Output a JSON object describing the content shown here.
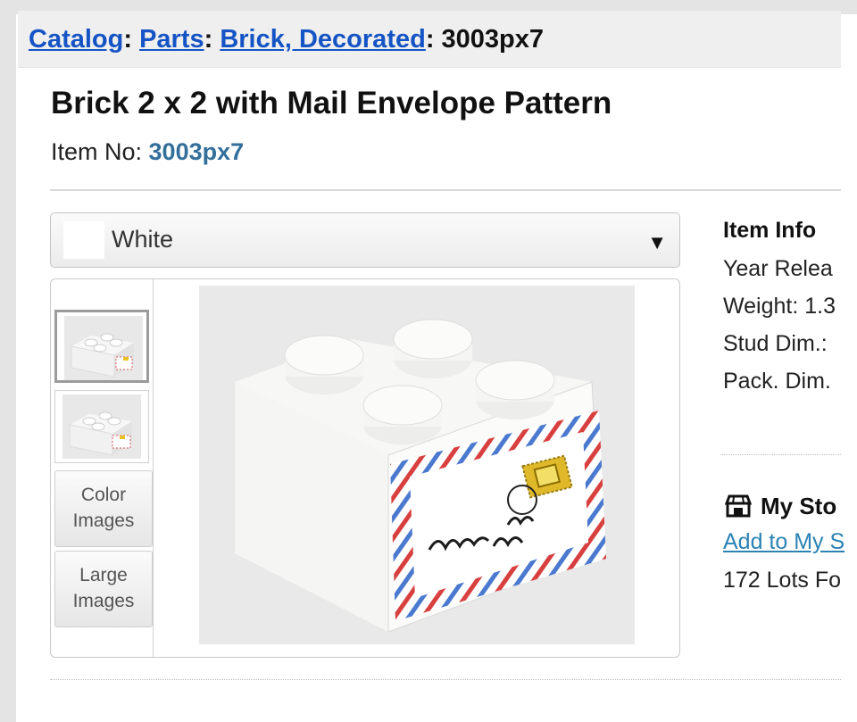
{
  "breadcrumb": {
    "items": [
      "Catalog",
      "Parts",
      "Brick, Decorated"
    ],
    "current": "3003px7"
  },
  "item": {
    "title": "Brick 2 x 2 with Mail Envelope Pattern",
    "item_no_label": "Item No: ",
    "item_no": "3003px7"
  },
  "color_select": {
    "selected": "White",
    "swatch_color": "#ffffff"
  },
  "gallery": {
    "color_images_label_1": "Color",
    "color_images_label_2": "Images",
    "large_images_label_1": "Large",
    "large_images_label_2": "Images"
  },
  "item_info": {
    "heading": "Item Info",
    "rows": [
      "Year Relea",
      "Weight: 1.3",
      "Stud Dim.:",
      "Pack. Dim."
    ]
  },
  "my_store": {
    "heading": "My Sto",
    "link": "Add to My S",
    "lots": "172 Lots Fo"
  },
  "colors": {
    "link": "#1554c4",
    "item_no": "#336f9b",
    "store_link": "#2a83b4"
  }
}
